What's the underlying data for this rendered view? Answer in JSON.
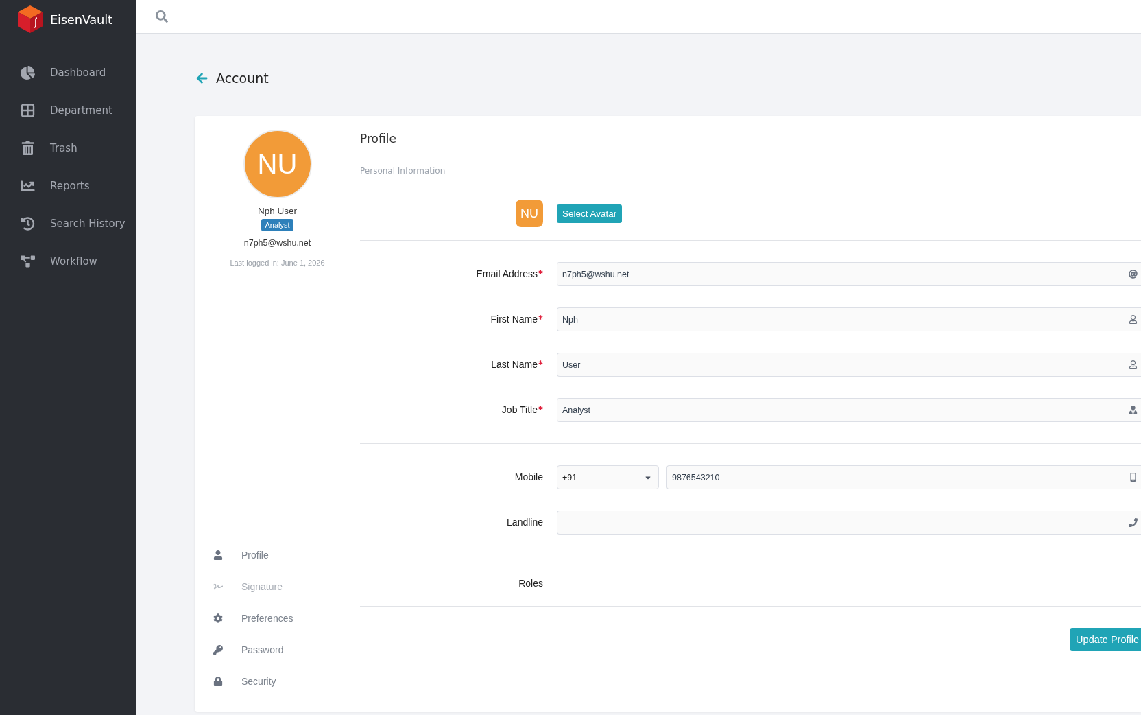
{
  "brand": {
    "name": "EisenVault"
  },
  "sidebar": {
    "items": [
      {
        "label": "Dashboard"
      },
      {
        "label": "Department"
      },
      {
        "label": "Trash"
      },
      {
        "label": "Reports"
      },
      {
        "label": "Search History"
      },
      {
        "label": "Workflow"
      }
    ]
  },
  "page": {
    "title": "Account"
  },
  "user_card": {
    "initials": "NU",
    "name": "Nph User",
    "badge": "Analyst",
    "email": "n7ph5@wshu.net",
    "last_login": "Last logged in: June 1, 2026"
  },
  "account_menu": {
    "items": [
      {
        "label": "Profile",
        "disabled": false
      },
      {
        "label": "Signature",
        "disabled": true
      },
      {
        "label": "Preferences",
        "disabled": false
      },
      {
        "label": "Password",
        "disabled": false
      },
      {
        "label": "Security",
        "disabled": false
      }
    ]
  },
  "form": {
    "title": "Profile",
    "subtitle": "Personal Information",
    "avatar": {
      "initials": "NU",
      "button": "Select Avatar"
    },
    "sections": [
      {
        "fields": [
          {
            "kind": "email",
            "label": "Email Address",
            "required": true,
            "value": "n7ph5@wshu.net"
          },
          {
            "kind": "name",
            "label": "First Name",
            "required": true,
            "value": "Nph"
          },
          {
            "kind": "name",
            "label": "Last Name",
            "required": true,
            "value": "User"
          },
          {
            "kind": "job",
            "label": "Job Title",
            "required": true,
            "value": "Analyst"
          }
        ]
      },
      {
        "fields": [
          {
            "kind": "mobile",
            "label": "Mobile",
            "required": false,
            "country_code": "+91",
            "value": "9876543210"
          },
          {
            "kind": "landline",
            "label": "Landline",
            "required": false
          }
        ]
      },
      {
        "fields": [
          {
            "kind": "static",
            "label": "Roles",
            "required": false,
            "value": "–"
          }
        ]
      }
    ],
    "submit": "Update Profile"
  }
}
